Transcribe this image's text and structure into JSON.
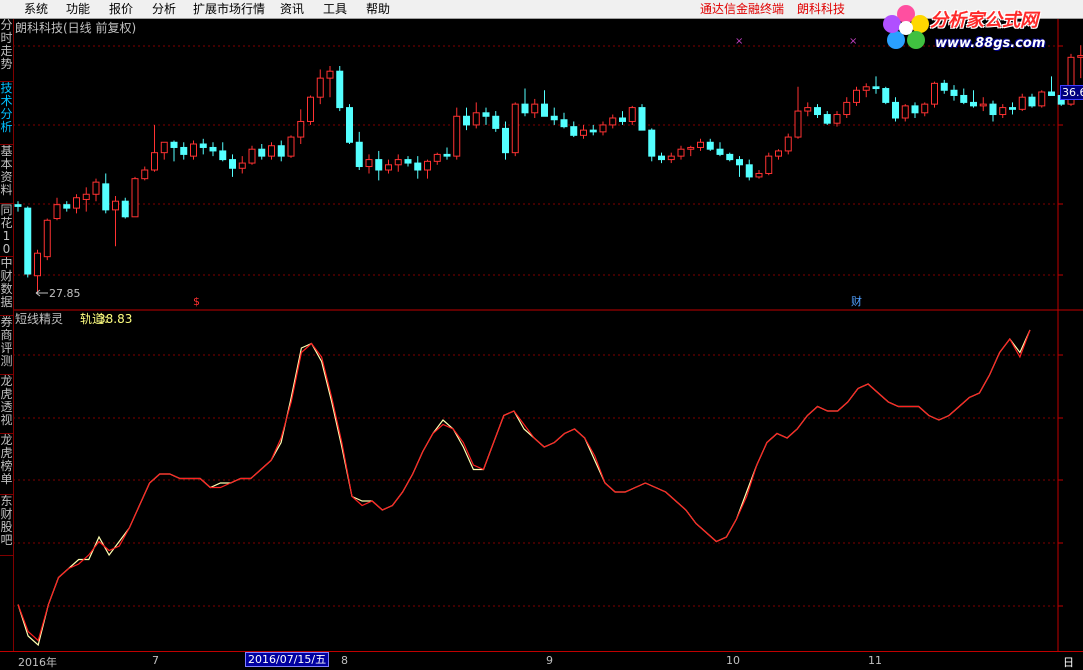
{
  "menu": {
    "items": [
      "系统",
      "功能",
      "报价",
      "分析",
      "扩展市场行情",
      "资讯",
      "工具",
      "帮助"
    ],
    "promo1": "通达信金融终端",
    "promo2": "朗科科技"
  },
  "logo": {
    "title": "分析家公式网",
    "url": "www.88gs.com"
  },
  "sidebar": {
    "tabs": [
      {
        "label": "分时走势",
        "active": false
      },
      {
        "label": "技术分析",
        "active": true
      },
      {
        "label": "基本资料",
        "active": false
      },
      {
        "label": "同花10",
        "active": false
      },
      {
        "label": "中财数据",
        "active": false
      },
      {
        "label": "券商评测",
        "active": false
      },
      {
        "label": "龙虎透视",
        "active": false
      },
      {
        "label": "龙虎榜单",
        "active": false
      },
      {
        "label": "东财股吧",
        "active": false
      }
    ]
  },
  "upper_panel": {
    "title": "朗科科技(日线 前复权)",
    "low_marker": "27.85",
    "price_tag": "36.6",
    "event_mark_s": "$",
    "event_mark_cai": "财"
  },
  "lower_panel": {
    "indicator_name": "短线精灵",
    "series_label": "轨道:",
    "series_value": "38.83"
  },
  "bottom_axis": {
    "labels": [
      "2016年",
      "7",
      "8",
      "9",
      "10",
      "11"
    ],
    "highlight": "2016/07/15/五",
    "right_label": "日"
  },
  "colors": {
    "up": "#ff3232",
    "down": "#54ffff",
    "line1": "#ff2020",
    "line2": "#ffffb0",
    "grid": "#800000"
  },
  "chart_data": {
    "type": "candlestick",
    "candles": [
      [
        33,
        33.2,
        32.6,
        32.9
      ],
      [
        32.8,
        32.9,
        28.8,
        29.0
      ],
      [
        28.9,
        30.4,
        27.85,
        30.2
      ],
      [
        30.0,
        32.2,
        29.8,
        32.1
      ],
      [
        32.2,
        33.4,
        32.1,
        33.0
      ],
      [
        33.0,
        33.2,
        32.6,
        32.8
      ],
      [
        32.8,
        33.6,
        32.5,
        33.4
      ],
      [
        33.3,
        34.0,
        32.6,
        33.6
      ],
      [
        33.6,
        34.5,
        33.2,
        34.3
      ],
      [
        34.2,
        34.8,
        32.5,
        32.7
      ],
      [
        32.7,
        33.5,
        30.6,
        33.2
      ],
      [
        33.2,
        33.4,
        32.2,
        32.3
      ],
      [
        32.3,
        34.6,
        32.3,
        34.5
      ],
      [
        34.5,
        35.2,
        34.4,
        35.0
      ],
      [
        35.0,
        37.6,
        34.9,
        36.0
      ],
      [
        36.0,
        36.6,
        35.6,
        36.6
      ],
      [
        36.6,
        36.7,
        35.5,
        36.3
      ],
      [
        36.3,
        36.6,
        35.6,
        35.9
      ],
      [
        35.8,
        36.7,
        35.6,
        36.5
      ],
      [
        36.5,
        36.8,
        35.9,
        36.3
      ],
      [
        36.3,
        36.6,
        35.8,
        36.1
      ],
      [
        36.1,
        36.6,
        35.5,
        35.6
      ],
      [
        35.6,
        35.9,
        34.6,
        35.1
      ],
      [
        35.1,
        35.8,
        34.8,
        35.4
      ],
      [
        35.4,
        36.4,
        35.3,
        36.2
      ],
      [
        36.2,
        36.5,
        35.6,
        35.8
      ],
      [
        35.8,
        36.6,
        35.6,
        36.4
      ],
      [
        36.4,
        36.7,
        35.5,
        35.8
      ],
      [
        35.8,
        37.0,
        35.7,
        36.9
      ],
      [
        36.9,
        38.5,
        36.5,
        37.8
      ],
      [
        37.8,
        39.3,
        37.6,
        39.2
      ],
      [
        39.2,
        40.8,
        38.8,
        40.3
      ],
      [
        40.3,
        41.0,
        39.2,
        40.7
      ],
      [
        40.7,
        41.0,
        38.4,
        38.6
      ],
      [
        38.6,
        38.8,
        36.5,
        36.6
      ],
      [
        36.6,
        37.2,
        35.0,
        35.2
      ],
      [
        35.2,
        35.9,
        34.8,
        35.6
      ],
      [
        35.6,
        36.1,
        34.4,
        35.0
      ],
      [
        35.0,
        35.6,
        34.8,
        35.3
      ],
      [
        35.3,
        35.9,
        34.9,
        35.6
      ],
      [
        35.6,
        35.8,
        35.2,
        35.4
      ],
      [
        35.4,
        35.8,
        34.5,
        35.0
      ],
      [
        35.0,
        35.6,
        34.5,
        35.5
      ],
      [
        35.5,
        36.0,
        35.3,
        35.9
      ],
      [
        35.9,
        36.3,
        35.6,
        35.8
      ],
      [
        35.8,
        38.6,
        35.6,
        38.1
      ],
      [
        38.1,
        38.6,
        37.3,
        37.6
      ],
      [
        37.6,
        38.9,
        37.4,
        38.3
      ],
      [
        38.3,
        38.6,
        37.6,
        38.1
      ],
      [
        38.1,
        38.4,
        37.2,
        37.4
      ],
      [
        37.4,
        37.8,
        35.6,
        36.0
      ],
      [
        36.0,
        38.9,
        35.8,
        38.8
      ],
      [
        38.8,
        39.7,
        38.1,
        38.3
      ],
      [
        38.3,
        39.1,
        38.0,
        38.8
      ],
      [
        38.8,
        39.6,
        38.1,
        38.1
      ],
      [
        38.1,
        38.6,
        37.6,
        37.9
      ],
      [
        37.9,
        38.3,
        37.4,
        37.5
      ],
      [
        37.5,
        37.8,
        36.9,
        37.0
      ],
      [
        37.0,
        37.6,
        36.8,
        37.3
      ],
      [
        37.3,
        37.6,
        37.0,
        37.2
      ],
      [
        37.2,
        37.8,
        37.0,
        37.6
      ],
      [
        37.6,
        38.2,
        37.4,
        38.0
      ],
      [
        38.0,
        38.4,
        37.6,
        37.8
      ],
      [
        37.8,
        38.7,
        37.6,
        38.6
      ],
      [
        38.6,
        38.8,
        37.6,
        37.3
      ],
      [
        37.3,
        37.4,
        35.5,
        35.8
      ],
      [
        35.8,
        36.0,
        35.4,
        35.6
      ],
      [
        35.6,
        36.0,
        35.4,
        35.8
      ],
      [
        35.8,
        36.4,
        35.6,
        36.2
      ],
      [
        36.2,
        36.4,
        35.8,
        36.3
      ],
      [
        36.3,
        36.8,
        36.1,
        36.6
      ],
      [
        36.6,
        36.8,
        36.1,
        36.2
      ],
      [
        36.2,
        36.6,
        35.8,
        35.9
      ],
      [
        35.9,
        36.0,
        35.5,
        35.6
      ],
      [
        35.6,
        35.8,
        34.6,
        35.3
      ],
      [
        35.3,
        35.6,
        34.4,
        34.6
      ],
      [
        34.6,
        35.0,
        34.5,
        34.8
      ],
      [
        34.8,
        36.0,
        34.7,
        35.8
      ],
      [
        35.8,
        36.2,
        35.6,
        36.1
      ],
      [
        36.1,
        37.1,
        35.9,
        36.9
      ],
      [
        36.9,
        39.8,
        36.8,
        38.4
      ],
      [
        38.4,
        38.9,
        38.1,
        38.6
      ],
      [
        38.6,
        38.8,
        38.0,
        38.2
      ],
      [
        38.2,
        38.4,
        37.6,
        37.7
      ],
      [
        37.7,
        38.4,
        37.5,
        38.2
      ],
      [
        38.2,
        39.2,
        38.0,
        38.9
      ],
      [
        38.9,
        39.8,
        38.7,
        39.6
      ],
      [
        39.6,
        40.0,
        39.2,
        39.8
      ],
      [
        39.8,
        40.4,
        39.4,
        39.7
      ],
      [
        39.7,
        39.8,
        38.8,
        38.9
      ],
      [
        38.9,
        39.2,
        37.8,
        38.0
      ],
      [
        38.0,
        38.8,
        37.8,
        38.7
      ],
      [
        38.7,
        38.9,
        38.0,
        38.3
      ],
      [
        38.3,
        38.9,
        38.1,
        38.8
      ],
      [
        38.8,
        40.1,
        38.6,
        40.0
      ],
      [
        40.0,
        40.2,
        39.4,
        39.6
      ],
      [
        39.6,
        39.9,
        39.0,
        39.3
      ],
      [
        39.3,
        39.7,
        38.8,
        38.9
      ],
      [
        38.9,
        39.6,
        38.6,
        38.7
      ],
      [
        38.7,
        39.2,
        38.4,
        38.8
      ],
      [
        38.8,
        39.0,
        37.8,
        38.2
      ],
      [
        38.2,
        38.8,
        38.0,
        38.6
      ],
      [
        38.6,
        38.9,
        38.2,
        38.5
      ],
      [
        38.5,
        39.4,
        38.4,
        39.2
      ],
      [
        39.2,
        39.4,
        38.6,
        38.7
      ],
      [
        38.7,
        39.6,
        38.6,
        39.5
      ],
      [
        39.5,
        40.4,
        39.3,
        39.3
      ],
      [
        39.3,
        39.6,
        38.7,
        38.8
      ],
      [
        38.8,
        41.7,
        38.7,
        41.5
      ],
      [
        41.5,
        42.2,
        40.3,
        41.6
      ],
      [
        41.6,
        41.9,
        40.0,
        41.5
      ],
      [
        41.5,
        41.9,
        40.8,
        40.9
      ],
      [
        40.9,
        42.4,
        40.6,
        42.3
      ]
    ],
    "y_axis": {
      "min": 27.5,
      "max": 42.5,
      "price_tag": 36.6
    },
    "indicator": {
      "name": "短线精灵",
      "series": [
        {
          "name": "轨道",
          "values": [
            34.2,
            33.6,
            33.4,
            34.2,
            34.8,
            35.0,
            35.1,
            35.3,
            35.6,
            35.4,
            35.5,
            35.9,
            36.4,
            36.9,
            37.1,
            37.1,
            37.0,
            37.0,
            37.0,
            36.8,
            36.8,
            36.9,
            37.0,
            37.0,
            37.2,
            37.4,
            37.9,
            38.7,
            39.8,
            40.0,
            39.7,
            38.8,
            37.8,
            36.6,
            36.4,
            36.5,
            36.3,
            36.4,
            36.7,
            37.1,
            37.6,
            38.0,
            38.2,
            38.1,
            37.8,
            37.3,
            37.2,
            37.8,
            38.4,
            38.5,
            38.2,
            37.9,
            37.7,
            37.8,
            38.0,
            38.1,
            37.9,
            37.5,
            36.9,
            36.7,
            36.7,
            36.8,
            36.9,
            36.8,
            36.7,
            36.5,
            36.3,
            36.0,
            35.8,
            35.6,
            35.7,
            36.1,
            36.6,
            37.3,
            37.8,
            38.0,
            37.9,
            38.1,
            38.4,
            38.6,
            38.5,
            38.5,
            38.7,
            39.0,
            39.1,
            38.9,
            38.7,
            38.6,
            38.6,
            38.6,
            38.4,
            38.3,
            38.4,
            38.6,
            38.8,
            38.9,
            39.3,
            39.8,
            40.1,
            39.7,
            40.3
          ]
        },
        {
          "name": "",
          "values": [
            34.2,
            33.5,
            33.3,
            34.2,
            34.8,
            35.0,
            35.2,
            35.2,
            35.7,
            35.3,
            35.6,
            35.9,
            36.4,
            36.9,
            37.1,
            37.1,
            37.0,
            37.0,
            37.0,
            36.8,
            36.9,
            36.9,
            37.0,
            37.0,
            37.2,
            37.4,
            37.8,
            38.8,
            39.9,
            40.0,
            39.6,
            38.7,
            37.7,
            36.6,
            36.5,
            36.5,
            36.3,
            36.4,
            36.7,
            37.1,
            37.6,
            38.0,
            38.3,
            38.1,
            37.7,
            37.2,
            37.2,
            37.8,
            38.4,
            38.5,
            38.1,
            37.9,
            37.7,
            37.8,
            38.0,
            38.1,
            37.9,
            37.4,
            36.9,
            36.7,
            36.7,
            36.8,
            36.9,
            36.8,
            36.7,
            36.5,
            36.3,
            36.0,
            35.8,
            35.6,
            35.7,
            36.1,
            36.7,
            37.3,
            37.8,
            38.0,
            37.9,
            38.1,
            38.4,
            38.6,
            38.5,
            38.5,
            38.7,
            39.0,
            39.1,
            38.9,
            38.7,
            38.6,
            38.6,
            38.6,
            38.4,
            38.3,
            38.4,
            38.6,
            38.8,
            38.9,
            39.3,
            39.8,
            40.1,
            39.8,
            40.3
          ]
        }
      ]
    }
  }
}
